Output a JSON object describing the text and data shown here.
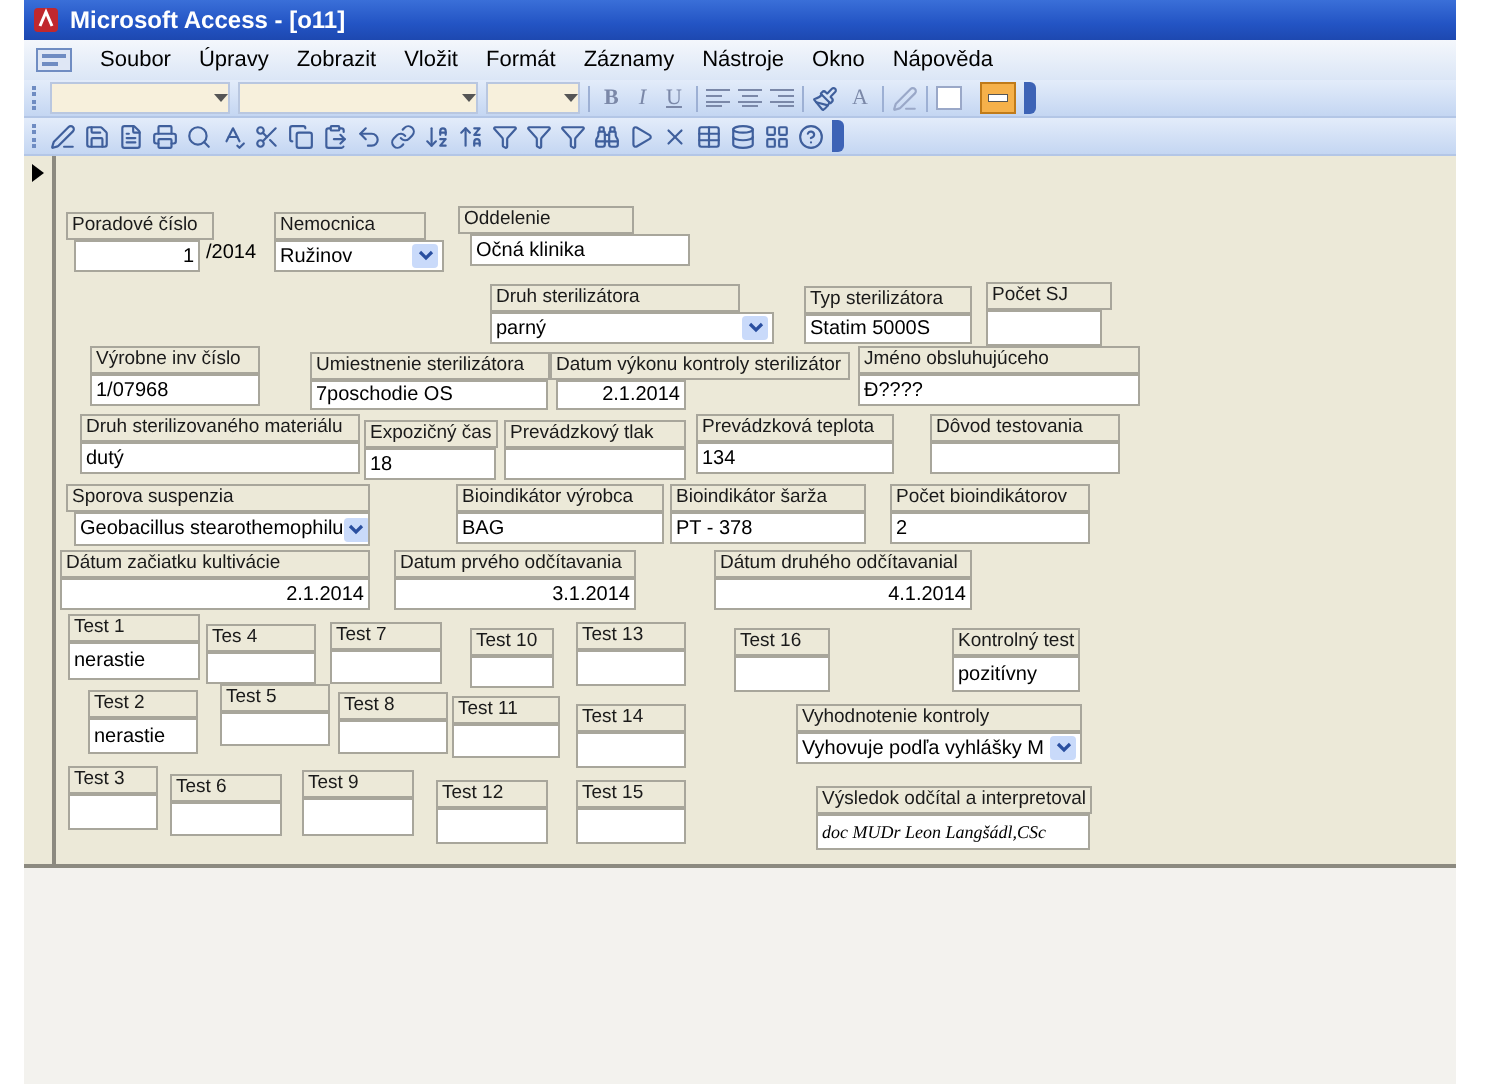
{
  "window": {
    "title": "Microsoft Access - [o11]"
  },
  "menu": [
    "Soubor",
    "Úpravy",
    "Zobrazit",
    "Vložit",
    "Formát",
    "Záznamy",
    "Nástroje",
    "Okno",
    "Nápověda"
  ],
  "format_buttons": [
    {
      "label": "B",
      "kind": "bold"
    },
    {
      "label": "I",
      "kind": "italic"
    },
    {
      "label": "U",
      "kind": "underline"
    }
  ],
  "font_color_button": "A",
  "fields": [
    {
      "label": "Poradové číslo",
      "value": "1",
      "suffix": "/2014",
      "kind": "text"
    },
    {
      "label": "Nemocnica",
      "value": "Ružinov",
      "kind": "combo"
    },
    {
      "label": "Oddelenie",
      "value": "Očná klinika",
      "kind": "text"
    },
    {
      "label": "Druh sterilizátora",
      "value": "parný",
      "kind": "combo"
    },
    {
      "label": "Typ sterilizátora",
      "value": "Statim 5000S",
      "kind": "text"
    },
    {
      "label": "Počet SJ",
      "kind": "text"
    },
    {
      "label": "Výrobne inv číslo",
      "value": "1/07968",
      "kind": "text"
    },
    {
      "label": "Umiestnenie sterilizátora",
      "value": "7poschodie OS",
      "kind": "text"
    },
    {
      "label": "Datum výkonu kontroly sterilizátor",
      "value": "2.1.2014",
      "kind": "text"
    },
    {
      "label": "Jméno obsluhujúceho",
      "value": "Ð????",
      "kind": "text"
    },
    {
      "label": "Druh sterilizovaného materiálu",
      "value": "dutý",
      "kind": "text"
    },
    {
      "label": "Expozičný čas",
      "value": "18",
      "kind": "text"
    },
    {
      "label": "Prevádzkový tlak",
      "kind": "text"
    },
    {
      "label": "Prevádzková teplota",
      "value": "134",
      "kind": "text"
    },
    {
      "label": "Dôvod testovania",
      "kind": "text"
    },
    {
      "label": "Sporova suspenzia",
      "value": "Geobacillus stearothemophilu",
      "kind": "combo"
    },
    {
      "label": "Bioindikátor výrobca",
      "value": "BAG",
      "kind": "text"
    },
    {
      "label": "Bioindikátor šarža",
      "value": "PT - 378",
      "kind": "text"
    },
    {
      "label": "Počet bioindikátorov",
      "value": "2",
      "kind": "text"
    },
    {
      "label": "Dátum začiatku kultivácie",
      "value": "2.1.2014",
      "kind": "text"
    },
    {
      "label": "Datum prvého odčítavania",
      "value": "3.1.2014",
      "kind": "text"
    },
    {
      "label": "Dátum druhého odčítavanial",
      "value": "4.1.2014",
      "kind": "text"
    },
    {
      "label": "Test 1",
      "value": "nerastie",
      "kind": "text"
    },
    {
      "label": "Tes 4",
      "kind": "text"
    },
    {
      "label": "Test 7",
      "kind": "text"
    },
    {
      "label": "Test 10",
      "kind": "text"
    },
    {
      "label": "Test 13",
      "kind": "text"
    },
    {
      "label": "Test 16",
      "kind": "text"
    },
    {
      "label": "Kontrolný test",
      "value": "pozitívny",
      "kind": "text"
    },
    {
      "label": "Test 2",
      "value": "nerastie",
      "kind": "text"
    },
    {
      "label": "Test 5",
      "kind": "text"
    },
    {
      "label": "Test 8",
      "kind": "text"
    },
    {
      "label": "Test 11",
      "kind": "text"
    },
    {
      "label": "Test 14",
      "kind": "text"
    },
    {
      "label": "Vyhodnotenie kontroly",
      "value": "Vyhovuje podľa vyhlášky M",
      "kind": "combo"
    },
    {
      "label": "Test 3",
      "kind": "text"
    },
    {
      "label": "Test 6",
      "kind": "text"
    },
    {
      "label": "Test 9",
      "kind": "text"
    },
    {
      "label": "Test 12",
      "kind": "text"
    },
    {
      "label": "Test 15",
      "kind": "text"
    },
    {
      "label": "Výsledok odčítal a interpretoval",
      "value": "doc MUDr Leon Langšádl,CSc",
      "kind": "script"
    }
  ]
}
